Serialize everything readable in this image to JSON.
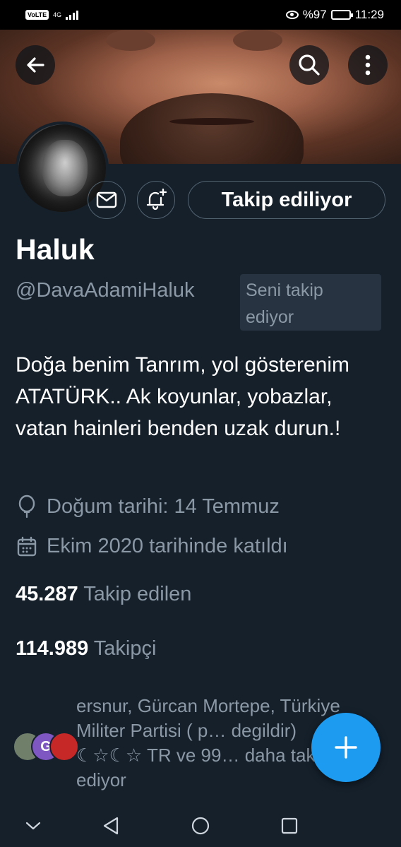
{
  "status_bar": {
    "volte": "VoLTE",
    "network": "4G",
    "battery_text": "%97",
    "battery_level": 0.97,
    "time": "11:29"
  },
  "header": {
    "back_icon": "arrow-left-icon",
    "search_icon": "search-icon",
    "more_icon": "more-vertical-icon"
  },
  "profile": {
    "name": "Haluk",
    "handle": "@DavaAdamiHaluk",
    "follows_you_label": "Seni takip ediyor",
    "bio": "Doğa benim Tanrım, yol gösterenim ATATÜRK.. Ak koyunlar, yobazlar, vatan hainleri benden uzak durun.!",
    "birthday": "Doğum tarihi: 14 Temmuz",
    "joined": "Ekim 2020 tarihinde katıldı",
    "following_count": "45.287",
    "following_label": "Takip edilen",
    "followers_count": "114.989",
    "followers_label": "Takipçi",
    "known_followers": "ersnur, Gürcan Mortepe, Türkiye Militer Partisi ( p… degildir) ☾☆☾☆ TR ve 99… daha takip ediyor"
  },
  "actions": {
    "message_icon": "envelope-icon",
    "notify_icon": "bell-plus-icon",
    "follow_button_label": "Takip ediliyor"
  },
  "mini_avatars": [
    {
      "letter": "",
      "color": "#6f7f6a"
    },
    {
      "letter": "G",
      "color": "#7e57c2"
    },
    {
      "letter": "",
      "color": "#c62828"
    }
  ],
  "fab": {
    "icon": "plus-icon"
  },
  "nav": {
    "icons": [
      "chevron-down-icon",
      "back-triangle-icon",
      "home-circle-icon",
      "recents-square-icon"
    ]
  },
  "colors": {
    "background": "#15202b",
    "accent": "#1d9bf0",
    "secondary_text": "#8b98a5"
  }
}
